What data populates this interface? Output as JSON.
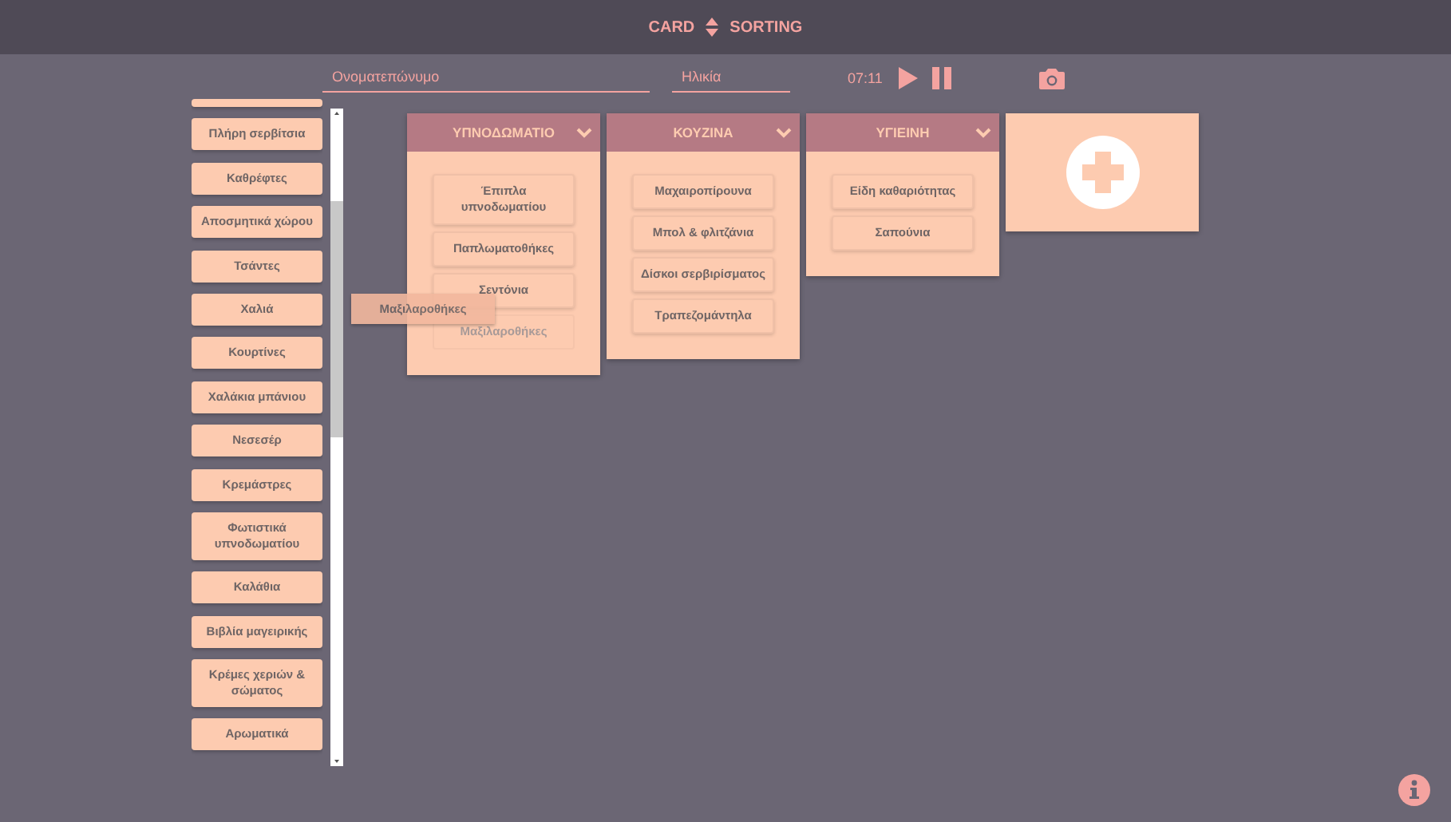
{
  "header": {
    "title_left": "CARD",
    "title_right": "SORTING"
  },
  "toolbar": {
    "name_field": {
      "placeholder": "Ονοματεπώνυμο"
    },
    "age_field": {
      "placeholder": "Ηλικία"
    },
    "timer": "07:11"
  },
  "sidebar": {
    "cards": [
      "Πλήρη σερβίτσια",
      "Καθρέφτες",
      "Αποσμητικά χώρου",
      "Τσάντες",
      "Χαλιά",
      "Κουρτίνες",
      "Χαλάκια μπάνιου",
      "Νεσεσέρ",
      "Κρεμάστρες",
      "Φωτιστικά υπνοδωματίου",
      "Καλάθια",
      "Βιβλία μαγειρικής",
      "Κρέμες χεριών & σώματος",
      "Αρωματικά"
    ]
  },
  "dragged_card": {
    "label": "Μαξιλαροθήκες"
  },
  "categories": [
    {
      "title": "ΥΠΝΟΔΩΜΑΤΙΟ",
      "cards": [
        {
          "label": "Έπιπλα υπνοδωματίου",
          "placeholder": false
        },
        {
          "label": "Παπλωματοθήκες",
          "placeholder": false
        },
        {
          "label": "Σεντόνια",
          "placeholder": false
        },
        {
          "label": "Μαξιλαροθήκες",
          "placeholder": true
        }
      ]
    },
    {
      "title": "ΚΟΥΖΙΝΑ",
      "cards": [
        {
          "label": "Μαχαιροπίρουνα",
          "placeholder": false
        },
        {
          "label": "Μπολ & φλιτζάνια",
          "placeholder": false
        },
        {
          "label": "Δίσκοι σερβιρίσματος",
          "placeholder": false
        },
        {
          "label": "Τραπεζομάντηλα",
          "placeholder": false
        }
      ]
    },
    {
      "title": "ΥΓΙΕΙΝΗ",
      "cards": [
        {
          "label": "Είδη καθαριότητας",
          "placeholder": false
        },
        {
          "label": "Σαπούνια",
          "placeholder": false
        }
      ]
    }
  ]
}
